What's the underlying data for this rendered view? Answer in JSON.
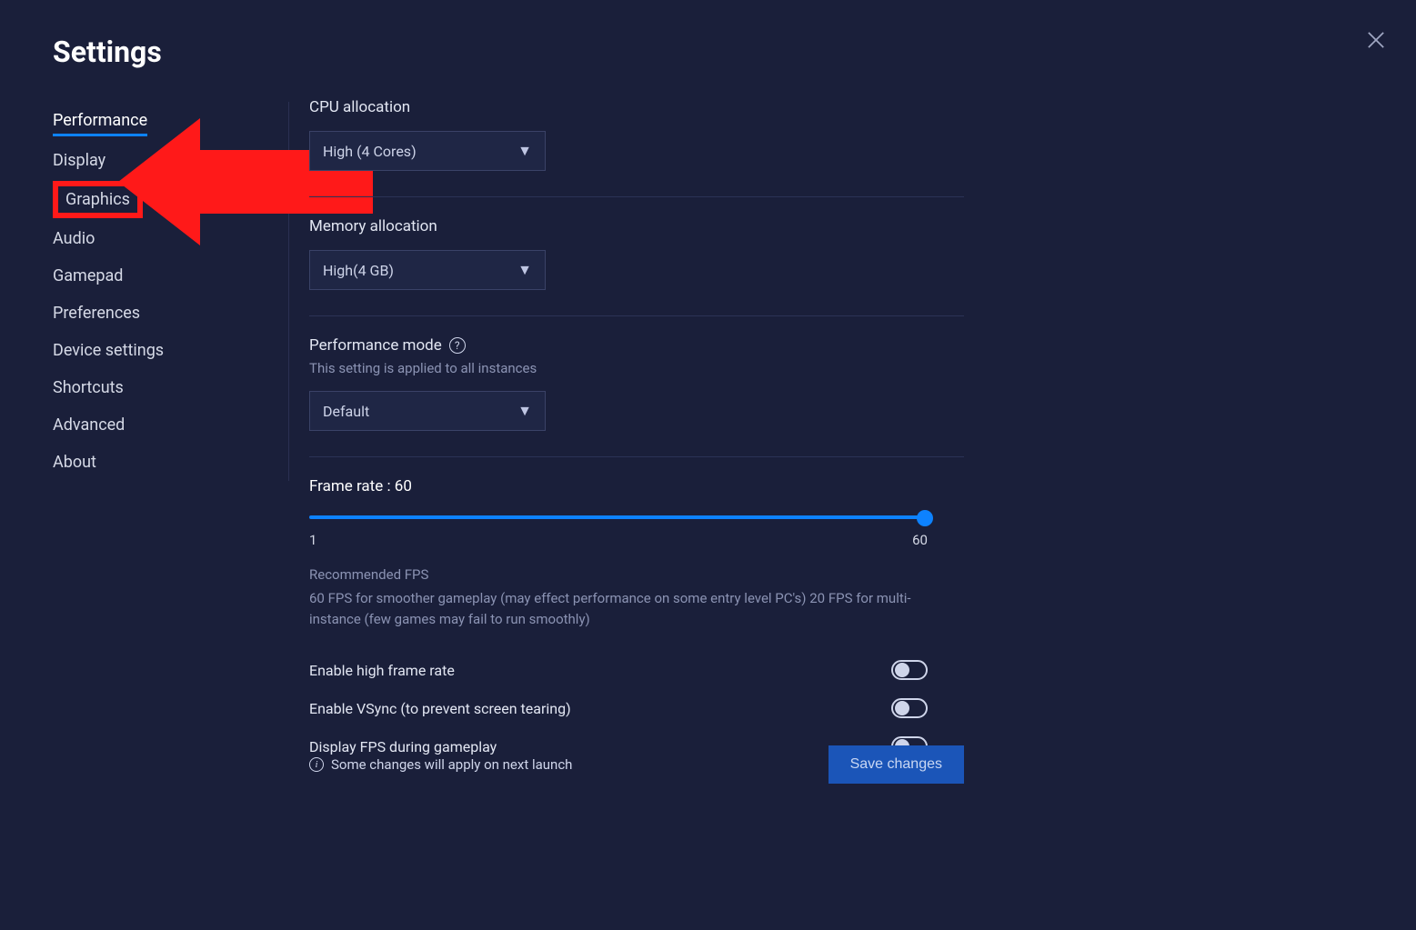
{
  "title": "Settings",
  "sidebar": {
    "items": [
      {
        "label": "Performance",
        "active": true
      },
      {
        "label": "Display"
      },
      {
        "label": "Graphics",
        "highlighted": true
      },
      {
        "label": "Audio"
      },
      {
        "label": "Gamepad"
      },
      {
        "label": "Preferences"
      },
      {
        "label": "Device settings"
      },
      {
        "label": "Shortcuts"
      },
      {
        "label": "Advanced"
      },
      {
        "label": "About"
      }
    ]
  },
  "cpu": {
    "label": "CPU allocation",
    "value": "High (4 Cores)"
  },
  "memory": {
    "label": "Memory allocation",
    "value": "High(4 GB)"
  },
  "perfmode": {
    "label": "Performance mode",
    "sub": "This setting is applied to all instances",
    "value": "Default"
  },
  "framerate": {
    "label": "Frame rate : 60",
    "min": "1",
    "max": "60",
    "reco_title": "Recommended FPS",
    "reco_text": "60 FPS for smoother gameplay (may effect performance on some entry level PC's) 20 FPS for multi-instance (few games may fail to run smoothly)"
  },
  "toggles": {
    "hifps": "Enable high frame rate",
    "vsync": "Enable VSync (to prevent screen tearing)",
    "showfps": "Display FPS during gameplay"
  },
  "footer": {
    "note": "Some changes will apply on next launch",
    "save": "Save changes"
  }
}
